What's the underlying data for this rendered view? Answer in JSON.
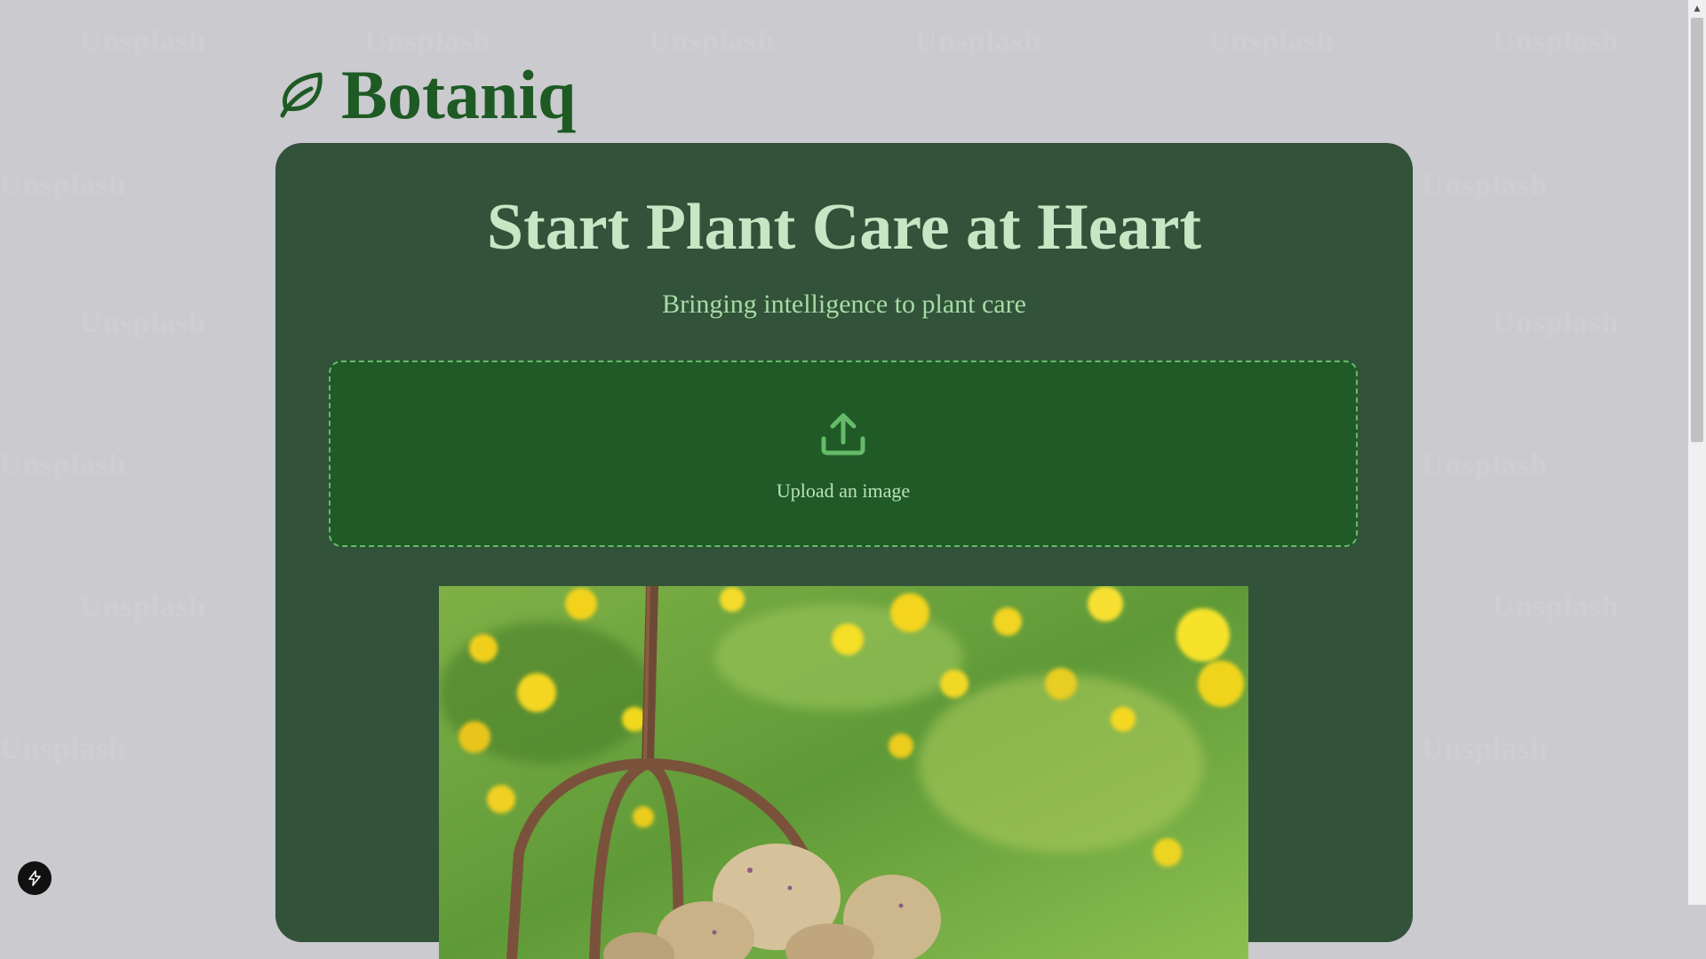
{
  "brand": {
    "name": "Botaniq",
    "icon": "leaf-icon",
    "color": "#1e5a24"
  },
  "hero": {
    "title": "Start Plant Care at Heart",
    "subtitle": "Bringing intelligence to plant care"
  },
  "upload": {
    "label": "Upload an image",
    "icon": "upload-icon"
  },
  "preview": {
    "image": "uploaded-plant-photo"
  },
  "dev_badge": {
    "icon": "lightning-icon"
  },
  "colors": {
    "page_background": "#cbcacf",
    "card_background": "#32523a",
    "upload_background": "#1f5a27",
    "upload_border": "#66bb6a",
    "title": "#c6e6c4",
    "subtitle": "#a6dca4"
  }
}
